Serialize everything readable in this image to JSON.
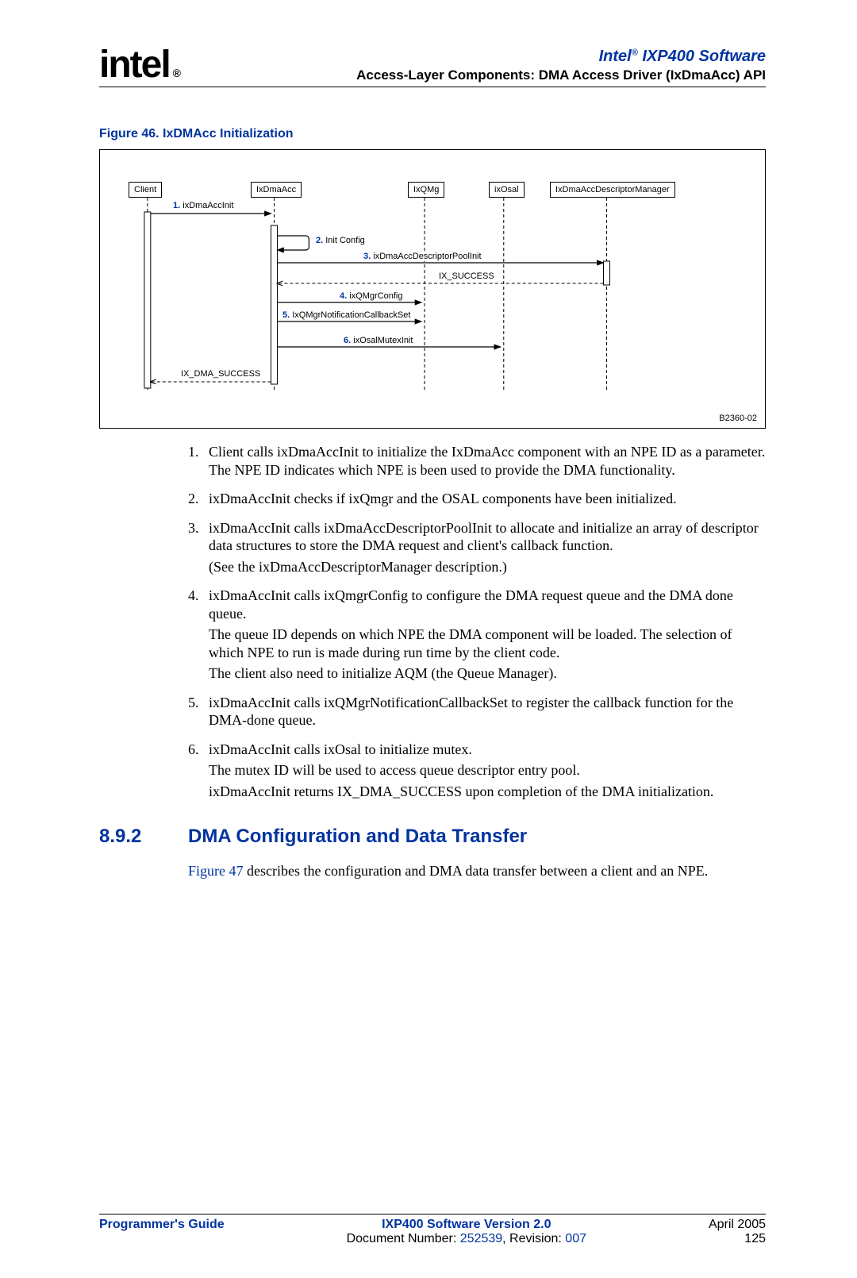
{
  "header": {
    "logo_text": "intel",
    "logo_reg": "®",
    "brand_line": "Intel",
    "brand_sup": "®",
    "brand_suffix": " IXP400 Software",
    "subtitle": "Access-Layer Components: DMA Access Driver (IxDmaAcc) API"
  },
  "figure": {
    "caption": "Figure 46. IxDMAcc Initialization",
    "code": "B2360-02"
  },
  "diagram": {
    "actors": {
      "client": "Client",
      "ixdmaacc": "IxDmaAcc",
      "ixqmg": "IxQMg",
      "ixosal": "ixOsal",
      "descmgr": "IxDmaAccDescriptorManager"
    },
    "msg1_num": "1.",
    "msg1_text": " ixDmaAccInit",
    "msg2_num": "2.",
    "msg2_text": " Init Config",
    "msg3_num": "3.",
    "msg3_text": " ixDmaAccDescriptorPoolInit",
    "msg3_ret": "IX_SUCCESS",
    "msg4_num": "4.",
    "msg4_text": " ixQMgrConfig",
    "msg5_num": "5.",
    "msg5_text": " IxQMgrNotificationCallbackSet",
    "msg6_num": "6.",
    "msg6_text": " ixOsalMutexInit",
    "ret_final": "IX_DMA_SUCCESS"
  },
  "list": {
    "i1": {
      "marker": "1.",
      "p1": "Client calls ixDmaAccInit to initialize the IxDmaAcc component with an NPE ID as a parameter. The NPE ID indicates which NPE is been used to provide the DMA functionality."
    },
    "i2": {
      "marker": "2.",
      "p1": "ixDmaAccInit checks if ixQmgr and the OSAL components have been initialized."
    },
    "i3": {
      "marker": "3.",
      "p1": "ixDmaAccInit calls ixDmaAccDescriptorPoolInit to allocate and initialize an array of descriptor data structures to store the DMA request and client's callback function.",
      "p2": "(See the ixDmaAccDescriptorManager description.)"
    },
    "i4": {
      "marker": "4.",
      "p1": "ixDmaAccInit calls ixQmgrConfig to configure the DMA request queue and the DMA done queue.",
      "p2": "The queue ID depends on which NPE the DMA component will be loaded. The selection of which NPE to run is made during run time by the client code.",
      "p3": "The client also need to initialize AQM (the Queue Manager)."
    },
    "i5": {
      "marker": "5.",
      "p1": "ixDmaAccInit calls ixQMgrNotificationCallbackSet to register the callback function for the DMA-done queue."
    },
    "i6": {
      "marker": "6.",
      "p1": "ixDmaAccInit calls ixOsal to initialize mutex.",
      "p2": "The mutex ID will be used to access queue descriptor entry pool.",
      "p3": "ixDmaAccInit returns IX_DMA_SUCCESS upon completion of the DMA initialization."
    }
  },
  "section": {
    "num": "8.9.2",
    "title": "DMA Configuration and Data Transfer",
    "para_link": "Figure 47",
    "para_rest": " describes the configuration and DMA data transfer between a client and an NPE."
  },
  "footer": {
    "left": "Programmer's Guide",
    "mid_l1": "IXP400 Software Version 2.0",
    "mid_l2_pre": "Document Number: ",
    "mid_l2_doc": "252539",
    "mid_l2_mid": ", Revision: ",
    "mid_l2_rev": "007",
    "right_l1": "April 2005",
    "right_l2": "125"
  }
}
